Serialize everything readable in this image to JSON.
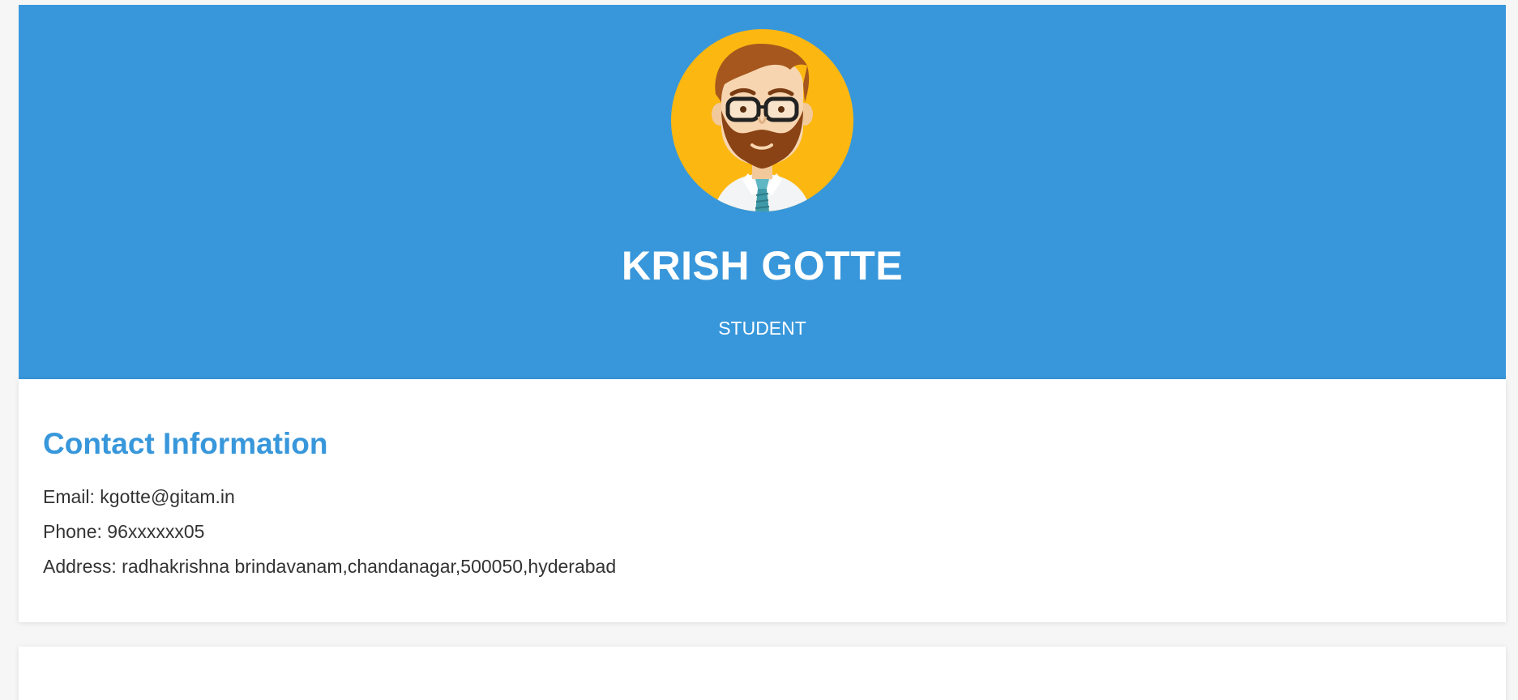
{
  "profile": {
    "name": "KRISH GOTTE",
    "role": "STUDENT",
    "avatar_icon": "bearded-man-avatar-icon",
    "header_color": "#3897db",
    "avatar_bg_color": "#fcb711"
  },
  "contact": {
    "title": "Contact Information",
    "email": "Email: kgotte@gitam.in",
    "phone": "Phone: 96xxxxxx05",
    "address": "Address: radhakrishna brindavanam,chandanagar,500050,hyderabad"
  }
}
